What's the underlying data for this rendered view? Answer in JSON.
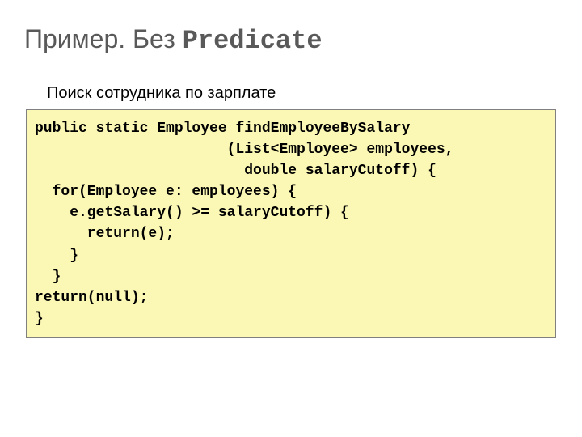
{
  "title": {
    "prefix": "Пример. Без ",
    "mono": "Predicate"
  },
  "subtitle": "Поиск сотрудника по зарплате",
  "code": "public static Employee findEmployeeBySalary\n                      (List<Employee> employees,\n                        double salaryCutoff) {\n  for(Employee e: employees) {\n    e.getSalary() >= salaryCutoff) {\n      return(e);\n    }\n  }\nreturn(null);\n}"
}
